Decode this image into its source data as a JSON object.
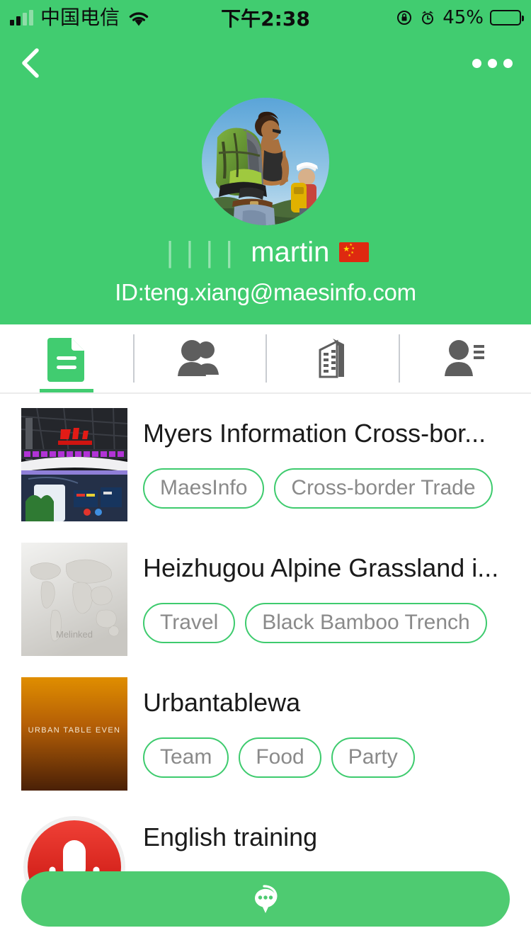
{
  "status_bar": {
    "carrier": "中国电信",
    "time": "下午2:38",
    "battery_percent": "45%",
    "battery_level": 45,
    "signal_icon": "signal-bars-icon",
    "wifi_icon": "wifi-icon",
    "rotation_lock_icon": "rotation-lock-icon",
    "alarm_icon": "alarm-clock-icon",
    "battery_icon": "battery-icon"
  },
  "nav_bar": {
    "back_icon": "back-chevron-icon",
    "more_icon": "more-options-icon"
  },
  "profile": {
    "avatar_icon": "avatar-photo-hikers",
    "name_prefix": "||||",
    "display_name": "martin",
    "country_flag": "china-flag-icon",
    "user_id": "ID:teng.xiang@maesinfo.com"
  },
  "tabs": [
    {
      "name": "tab-documents",
      "icon": "document-icon",
      "active": true
    },
    {
      "name": "tab-groups",
      "icon": "people-group-icon",
      "active": false
    },
    {
      "name": "tab-company",
      "icon": "building-icon",
      "active": false
    },
    {
      "name": "tab-contacts",
      "icon": "person-list-icon",
      "active": false
    }
  ],
  "list": [
    {
      "title": "Myers Information Cross-bor...",
      "thumbnail": "exhibition-booth-photo",
      "tags": [
        "MaesInfo",
        "Cross-border Trade"
      ]
    },
    {
      "title": "Heizhugou Alpine Grassland i...",
      "thumbnail": "world-map-placeholder",
      "thumbnail_watermark": "Melinked",
      "tags": [
        "Travel",
        "Black Bamboo Trench"
      ]
    },
    {
      "title": "Urbantablewa",
      "thumbnail": "urban-table-gradient",
      "thumbnail_caption": "URBAN TABLE EVEN",
      "tags": [
        "Team",
        "Food",
        "Party"
      ]
    },
    {
      "title": "English training",
      "thumbnail": "red-microphone-icon",
      "tags": []
    }
  ],
  "floating_button": {
    "icon": "chat-bubble-icon"
  },
  "colors": {
    "brand_green": "#41cc70",
    "tag_border_green": "#3ecb6e",
    "fab_green": "#4ecb71",
    "tag_text_gray": "#8a8a8a",
    "title_black": "#1a1a1a",
    "flag_red": "#de2910",
    "mic_red": "#e0201b"
  }
}
